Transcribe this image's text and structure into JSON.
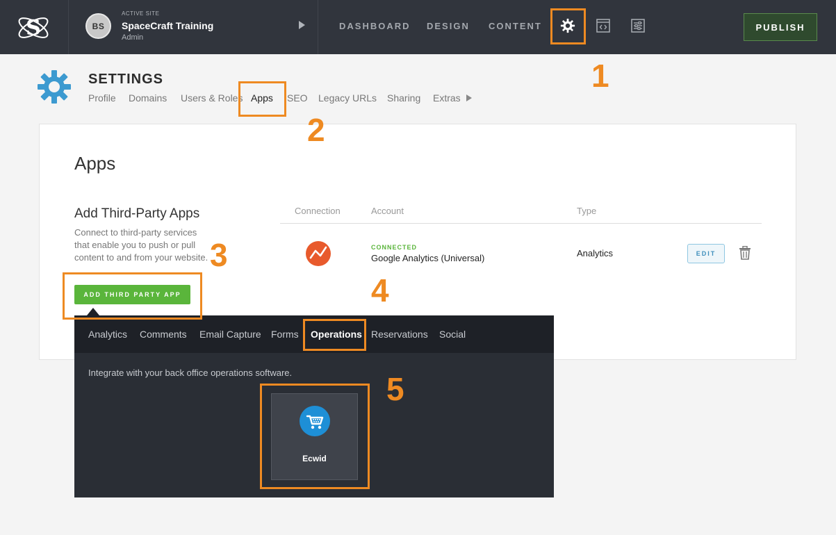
{
  "topbar": {
    "site_label": "ACTIVE SITE",
    "site_initials": "BS",
    "site_name": "SpaceCraft Training",
    "site_role": "Admin",
    "nav": [
      "DASHBOARD",
      "DESIGN",
      "CONTENT"
    ],
    "icons": [
      "gear-icon",
      "code-window-icon",
      "sliders-icon"
    ],
    "publish_label": "PUBLISH"
  },
  "settings": {
    "title": "SETTINGS",
    "tabs": [
      "Profile",
      "Domains",
      "Users & Roles",
      "Apps",
      "SEO",
      "Legacy URLs",
      "Sharing",
      "Extras"
    ],
    "active_tab": "Apps"
  },
  "apps": {
    "title": "Apps",
    "add_title": "Add Third-Party Apps",
    "add_description": "Connect to third-party services that enable you to push or pull content to and from your website.",
    "add_button": "ADD THIRD PARTY APP",
    "table": {
      "headers": [
        "Connection",
        "Account",
        "Type"
      ],
      "rows": [
        {
          "status": "CONNECTED",
          "account": "Google Analytics (Universal)",
          "type": "Analytics",
          "edit_label": "EDIT"
        }
      ]
    }
  },
  "dropdown": {
    "tabs": [
      "Analytics",
      "Comments",
      "Email Capture",
      "Forms",
      "Operations",
      "Reservations",
      "Social"
    ],
    "active_tab": "Operations",
    "description": "Integrate with your back office operations software.",
    "apps": [
      {
        "name": "Ecwid"
      }
    ]
  },
  "annotations": [
    "1",
    "2",
    "3",
    "4",
    "5"
  ],
  "colors": {
    "topbar": "#31353d",
    "accent_annotation": "#ee8a22",
    "green": "#5ab53b",
    "gear_blue": "#3c9ad0"
  }
}
